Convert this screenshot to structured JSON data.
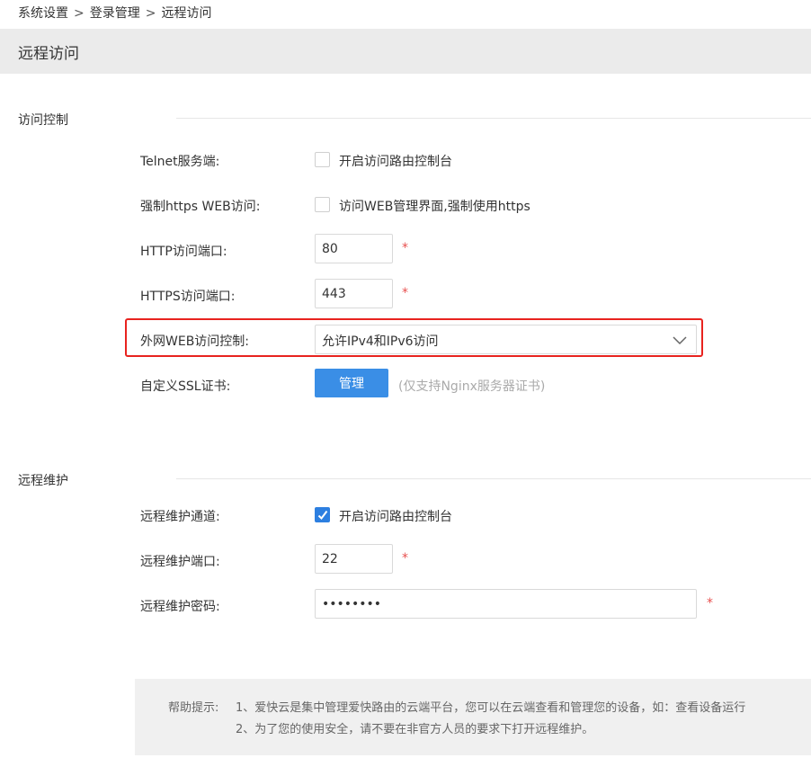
{
  "breadcrumb": {
    "items": [
      "系统设置",
      "登录管理",
      "远程访问"
    ],
    "separator": ">"
  },
  "page": {
    "title": "远程访问"
  },
  "access_control": {
    "section_title": "访问控制",
    "telnet": {
      "label": "Telnet服务端:",
      "checkbox_label": "开启访问路由控制台",
      "checked": false
    },
    "force_https": {
      "label": "强制https WEB访问:",
      "checkbox_label": "访问WEB管理界面,强制使用https",
      "checked": false
    },
    "http_port": {
      "label": "HTTP访问端口:",
      "value": "80",
      "required_mark": "*"
    },
    "https_port": {
      "label": "HTTPS访问端口:",
      "value": "443",
      "required_mark": "*"
    },
    "wan_web": {
      "label": "外网WEB访问控制:",
      "selected": "允许IPv4和IPv6访问"
    },
    "ssl_cert": {
      "label": "自定义SSL证书:",
      "button_label": "管理",
      "note": "(仅支持Nginx服务器证书)"
    }
  },
  "remote_maintenance": {
    "section_title": "远程维护",
    "channel": {
      "label": "远程维护通道:",
      "checkbox_label": "开启访问路由控制台",
      "checked": true
    },
    "port": {
      "label": "远程维护端口:",
      "value": "22",
      "required_mark": "*"
    },
    "password": {
      "label": "远程维护密码:",
      "value": "12345678",
      "required_mark": "*"
    }
  },
  "help": {
    "prefix": "帮助提示:",
    "line1": "1、爱快云是集中管理爱快路由的云端平台，您可以在云端查看和管理您的设备，如：查看设备运行",
    "line2": "2、为了您的使用安全，请不要在非官方人员的要求下打开远程维护。"
  },
  "colors": {
    "accent": "#3a8ee6",
    "checkbox_checked": "#2d7fe0",
    "required": "#e8504f",
    "highlight": "#e8231f",
    "header_bg": "#ebebeb"
  }
}
